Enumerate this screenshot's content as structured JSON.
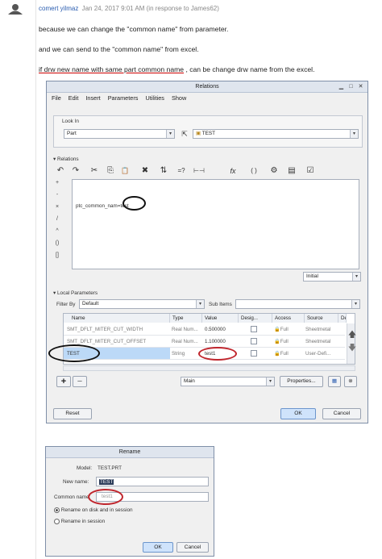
{
  "post": {
    "author": "comert yilmaz",
    "meta": "Jan 24, 2017 9:01 AM (in response to James62)",
    "line1": "because we can change the \"common name\" from parameter.",
    "line2": "and we can send to the \"common name\" from excel.",
    "line3_underlined": "if drw new name with same part common name",
    "line3_rest": ", can be change drw name from the excel."
  },
  "relations_dialog": {
    "title": "Relations",
    "menu": [
      "File",
      "Edit",
      "Insert",
      "Parameters",
      "Utilities",
      "Show"
    ],
    "look_in_label": "Look In",
    "look_in_value": "Part",
    "model_value": "TEST",
    "relations_label": "Relations",
    "relation_text_prefix": "ptc_common_nam",
    "relation_text_circled": "=test",
    "side_symbols": [
      "+",
      "-",
      "×",
      "/",
      "^",
      "()",
      "[]"
    ],
    "toolbar_glyphs": [
      "↶",
      "↷",
      "✂",
      "⎘",
      "📋",
      "✖",
      "⇅",
      "=?",
      "⊢⊣",
      "fx",
      "( )",
      "⚙",
      "▤",
      "☑"
    ],
    "initial_value": "Initial",
    "local_params_label": "Local Parameters",
    "filter_label": "Filter By",
    "filter_value": "Default",
    "sub_items_label": "Sub Items",
    "columns": [
      "Name",
      "Type",
      "Value",
      "Desig...",
      "Access",
      "Source",
      "De"
    ],
    "rows": [
      {
        "name": "SMT_DFLT_MITER_CUT_WIDTH",
        "type": "Real Num...",
        "value": "0.500000",
        "access": "Full",
        "source": "Sheetmetal"
      },
      {
        "name": "SMT_DFLT_MITER_CUT_OFFSET",
        "type": "Real Num...",
        "value": "1.100000",
        "access": "Full",
        "source": "Sheetmetal"
      },
      {
        "name": "TEST",
        "type": "String",
        "value": "test1",
        "access": "Full",
        "source": "User-Defi..."
      }
    ],
    "main_value": "Main",
    "properties_label": "Properties...",
    "reset_label": "Reset",
    "ok_label": "OK",
    "cancel_label": "Cancel"
  },
  "rename_dialog": {
    "title": "Rename",
    "model_label": "Model:",
    "model_value": "TEST.PRT",
    "new_name_label": "New name:",
    "new_name_value": "TEST",
    "common_name_label": "Common name:",
    "common_name_value": "test1",
    "radio1": "Rename on disk and in session",
    "radio2": "Rename in session",
    "ok_label": "OK",
    "cancel_label": "Cancel"
  }
}
